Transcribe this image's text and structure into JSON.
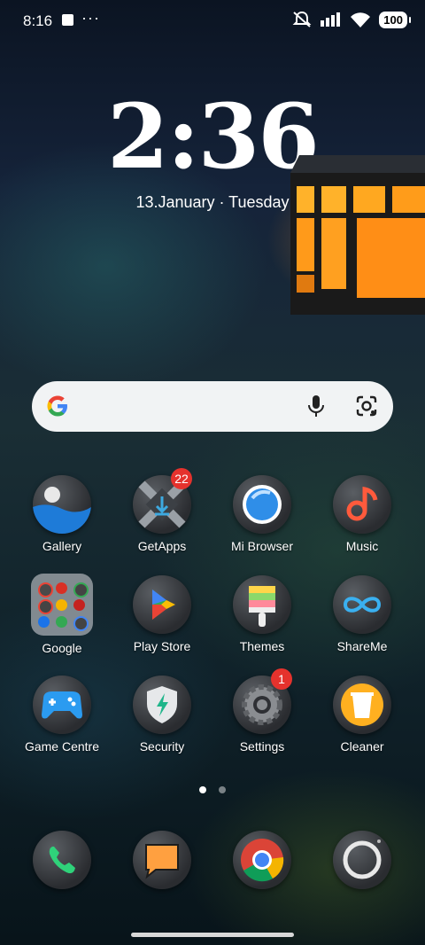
{
  "status_bar": {
    "time": "8:16",
    "more": "···",
    "battery": "100"
  },
  "clock": {
    "time": "2:36",
    "date": "13.January · Tuesday"
  },
  "search": {
    "google_icon": "google-g-icon",
    "mic_icon": "mic-icon",
    "lens_icon": "lens-icon"
  },
  "apps": [
    {
      "label": "Gallery"
    },
    {
      "label": "GetApps",
      "badge": "22"
    },
    {
      "label": "Mi Browser"
    },
    {
      "label": "Music"
    },
    {
      "label": "Google"
    },
    {
      "label": "Play Store"
    },
    {
      "label": "Themes"
    },
    {
      "label": "ShareMe"
    },
    {
      "label": "Game Centre"
    },
    {
      "label": "Security"
    },
    {
      "label": "Settings",
      "badge": "1"
    },
    {
      "label": "Cleaner"
    }
  ],
  "page_indicator": {
    "pages": 2,
    "current": 1
  },
  "dock": [
    "phone-icon",
    "messages-icon",
    "chrome-icon",
    "camera-icon"
  ]
}
